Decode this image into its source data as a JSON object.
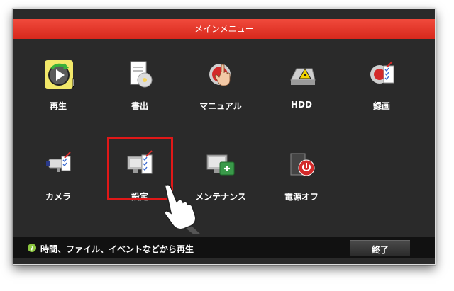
{
  "window": {
    "title": "メインメニュー"
  },
  "menu": {
    "items": [
      {
        "label": "再生",
        "icon": "playback-icon"
      },
      {
        "label": "書出",
        "icon": "export-icon"
      },
      {
        "label": "マニュアル",
        "icon": "manual-record-icon"
      },
      {
        "label": "HDD",
        "icon": "hdd-icon"
      },
      {
        "label": "録画",
        "icon": "record-icon"
      },
      {
        "label": "カメラ",
        "icon": "camera-icon"
      },
      {
        "label": "設定",
        "icon": "settings-icon"
      },
      {
        "label": "メンテナンス",
        "icon": "maintenance-icon"
      },
      {
        "label": "電源オフ",
        "icon": "power-off-icon"
      }
    ],
    "highlighted_item": "設定"
  },
  "status": {
    "help_text": "時間、ファイル、イベントなどから再生",
    "exit_label": "終了"
  },
  "colors": {
    "title_bar": "#e03a2e",
    "background": "#2a2a2a",
    "highlight_box": "#e01818"
  }
}
